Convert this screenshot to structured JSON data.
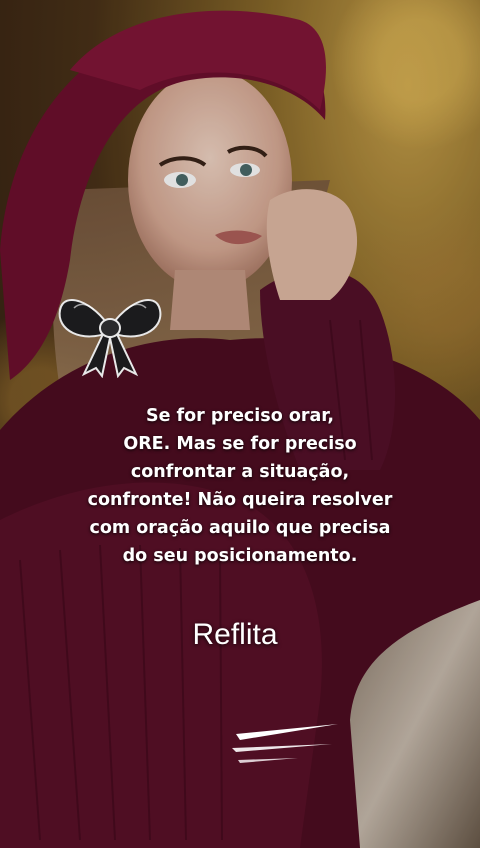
{
  "quote": {
    "lines": [
      "Se for preciso orar,",
      "ORE. Mas se for preciso",
      "confrontar a situação,",
      "confronte! Não queira resolver",
      "com oração aquilo que precisa",
      "do seu posicionamento."
    ]
  },
  "caption": "Reflita",
  "icons": {
    "bow": "bow-icon",
    "swoosh": "swoosh-icon"
  },
  "colors": {
    "hat": "#6e0f2e",
    "sweater": "#4e0d22",
    "background": "#8a6a2a",
    "text": "#ffffff"
  }
}
